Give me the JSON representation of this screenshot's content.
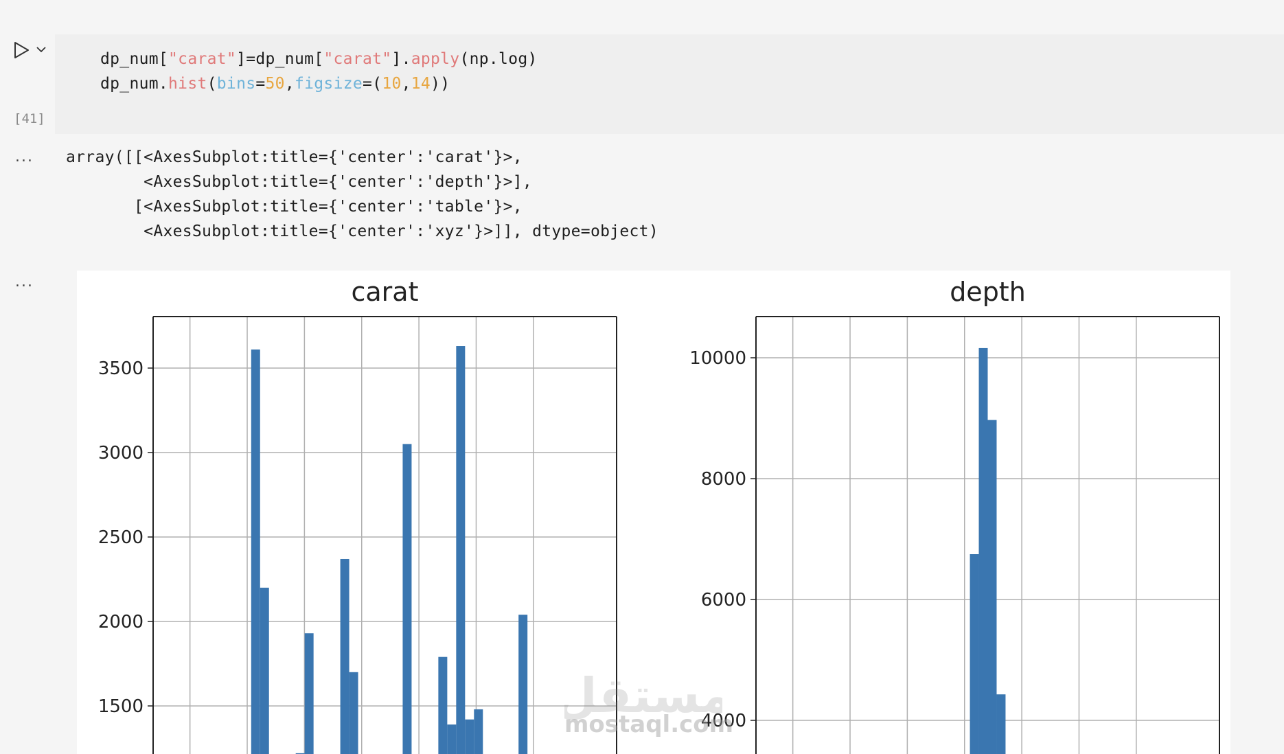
{
  "cell": {
    "execution_count": "[41]",
    "code_lines": [
      [
        {
          "t": "dp_num[",
          "c": "plain"
        },
        {
          "t": "\"carat\"",
          "c": "str"
        },
        {
          "t": "]=dp_num[",
          "c": "plain"
        },
        {
          "t": "\"carat\"",
          "c": "str"
        },
        {
          "t": "].",
          "c": "plain"
        },
        {
          "t": "apply",
          "c": "fn"
        },
        {
          "t": "(np.log)",
          "c": "plain"
        }
      ],
      [
        {
          "t": "dp_num.",
          "c": "plain"
        },
        {
          "t": "hist",
          "c": "fn"
        },
        {
          "t": "(",
          "c": "plain"
        },
        {
          "t": "bins",
          "c": "kw"
        },
        {
          "t": "=",
          "c": "plain"
        },
        {
          "t": "50",
          "c": "num"
        },
        {
          "t": ",",
          "c": "plain"
        },
        {
          "t": "figsize",
          "c": "kw"
        },
        {
          "t": "=(",
          "c": "plain"
        },
        {
          "t": "10",
          "c": "num"
        },
        {
          "t": ",",
          "c": "plain"
        },
        {
          "t": "14",
          "c": "num"
        },
        {
          "t": "))",
          "c": "plain"
        }
      ]
    ]
  },
  "output": {
    "more_label": "...",
    "text_lines": [
      "array([[<AxesSubplot:title={'center':'carat'}>,",
      "        <AxesSubplot:title={'center':'depth'}>],",
      "       [<AxesSubplot:title={'center':'table'}>,",
      "        <AxesSubplot:title={'center':'xyz'}>]], dtype=object)"
    ]
  },
  "watermark": {
    "arabic": "مستقل",
    "latin": "mostaql.com"
  },
  "colors": {
    "bar": "#3a76b0",
    "grid": "#b0b0b0",
    "string": "#e07a7a",
    "keyword": "#6fb3d9",
    "number": "#e8a640"
  },
  "chart_data": [
    {
      "type": "bar",
      "title": "carat",
      "xlabel": "",
      "ylabel": "",
      "yticks": [
        1500,
        2000,
        2500,
        3000,
        3500
      ],
      "ylim": [
        1170,
        3800
      ],
      "grid": true,
      "bars": [
        {
          "bin": 11,
          "value": 3610
        },
        {
          "bin": 12,
          "value": 2200
        },
        {
          "bin": 16,
          "value": 1220
        },
        {
          "bin": 17,
          "value": 1930
        },
        {
          "bin": 21,
          "value": 2370
        },
        {
          "bin": 22,
          "value": 1700
        },
        {
          "bin": 28,
          "value": 3050
        },
        {
          "bin": 32,
          "value": 1790
        },
        {
          "bin": 33,
          "value": 1390
        },
        {
          "bin": 34,
          "value": 3630
        },
        {
          "bin": 35,
          "value": 1420
        },
        {
          "bin": 36,
          "value": 1480
        },
        {
          "bin": 41,
          "value": 2040
        }
      ]
    },
    {
      "type": "bar",
      "title": "depth",
      "xlabel": "",
      "ylabel": "",
      "yticks": [
        4000,
        6000,
        8000,
        10000
      ],
      "ylim": [
        3450,
        11350
      ],
      "grid": true,
      "bars": [
        {
          "bin": 24,
          "value": 6750
        },
        {
          "bin": 25,
          "value": 10160
        },
        {
          "bin": 26,
          "value": 8970
        },
        {
          "bin": 27,
          "value": 4430
        }
      ]
    }
  ]
}
